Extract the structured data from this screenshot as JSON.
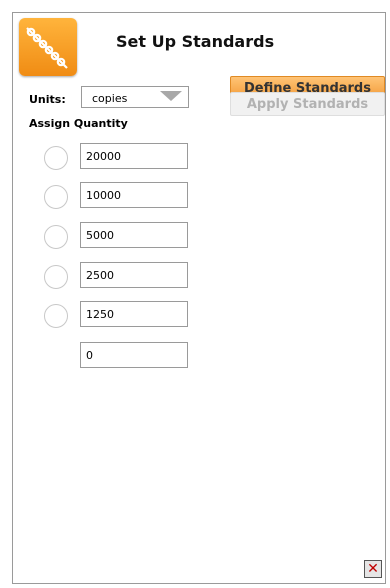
{
  "dialog": {
    "title": "Set Up Standards",
    "close_symbol": "✕"
  },
  "units": {
    "label": "Units:",
    "selected": "copies"
  },
  "assign_quantity": {
    "label": "Assign Quantity",
    "rows": [
      {
        "value": "20000",
        "has_radio": true
      },
      {
        "value": "10000",
        "has_radio": true
      },
      {
        "value": "5000",
        "has_radio": true
      },
      {
        "value": "2500",
        "has_radio": true
      },
      {
        "value": "1250",
        "has_radio": true
      },
      {
        "value": "0",
        "has_radio": false
      }
    ]
  },
  "buttons": {
    "define": "Define Standards",
    "apply": "Apply Standards"
  },
  "colors": {
    "accent_orange": "#f29a36",
    "disabled_text": "#b2b2b2",
    "close_red": "#c00000"
  },
  "icons": {
    "logo": "dilution-series-icon",
    "dropdown": "chevron-down-icon",
    "close": "close-icon"
  }
}
